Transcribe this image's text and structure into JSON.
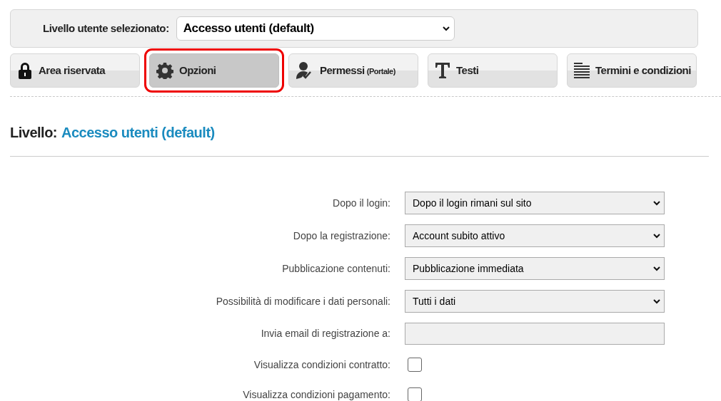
{
  "level_selector": {
    "label": "Livello utente selezionato:",
    "value": "Accesso utenti (default)"
  },
  "tabs": [
    {
      "kind": "lock",
      "label": "Area riservata",
      "selected": false
    },
    {
      "kind": "gear",
      "label": "Opzioni",
      "selected": true
    },
    {
      "kind": "user",
      "label": "Permessi",
      "note": "(Portale)",
      "selected": false
    },
    {
      "kind": "text",
      "label": "Testi",
      "selected": false
    },
    {
      "kind": "terms",
      "label": "Termini e condizioni",
      "selected": false
    }
  ],
  "heading": {
    "prefix": "Livello:",
    "level": "Accesso utenti (default)"
  },
  "form": [
    {
      "kind": "select",
      "label": "Dopo il login:",
      "value": "Dopo il login rimani sul sito"
    },
    {
      "kind": "select",
      "label": "Dopo la registrazione:",
      "value": "Account subito attivo"
    },
    {
      "kind": "select",
      "label": "Pubblicazione contenuti:",
      "value": "Pubblicazione immediata"
    },
    {
      "kind": "select",
      "label": "Possibilità di modificare i dati personali:",
      "value": "Tutti i dati"
    },
    {
      "kind": "text",
      "label": "Invia email di registrazione a:"
    },
    {
      "kind": "checkbox",
      "label": "Visualizza condizioni contratto:",
      "checked": false
    },
    {
      "kind": "checkbox",
      "label": "Visualizza condizioni pagamento:",
      "checked": false
    }
  ]
}
